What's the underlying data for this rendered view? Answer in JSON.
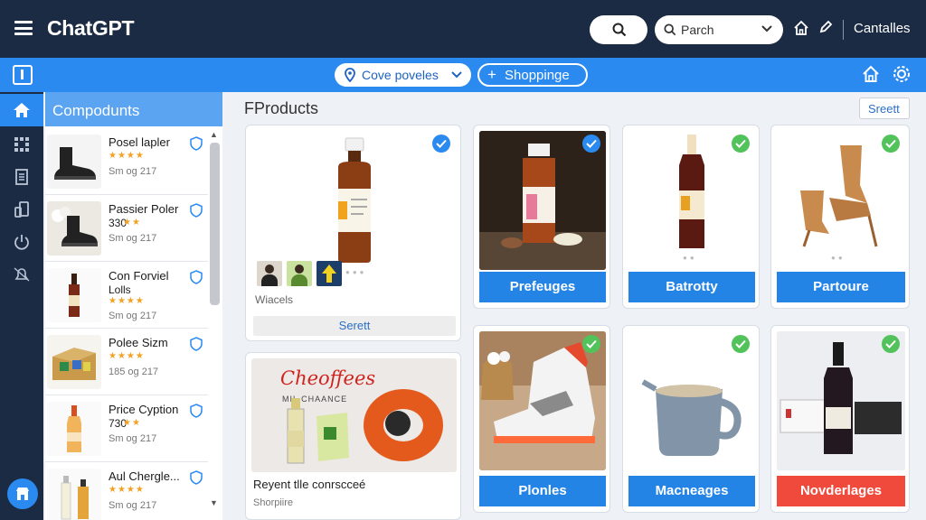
{
  "header": {
    "title": "ChatGPT",
    "search_placeholder": "Parch",
    "right_label": "Cantalles"
  },
  "toolbar": {
    "select_value": "Cove poveles",
    "shop_label": "Shoppinge"
  },
  "sidebar": {
    "title": "Compodunts",
    "items": [
      {
        "name": "Posel lapler",
        "stars": "★★★★",
        "meta": "Sm og 217",
        "sub": ""
      },
      {
        "name": "Passier Poler",
        "sub": "330",
        "stars": "★★",
        "meta": "Sm og 217"
      },
      {
        "name": "Con Forviel",
        "sub": "Lolls",
        "stars": "★★★★",
        "meta": "Sm og 217"
      },
      {
        "name": "Polee Sizm",
        "stars": "★★★★",
        "meta": "185 og 217",
        "sub": ""
      },
      {
        "name": "Price Cyption",
        "sub": "730",
        "stars": "★★",
        "meta": "Sm og 217"
      },
      {
        "name": "Aul Chergle...",
        "stars": "★★★★",
        "meta": "Sm og 217",
        "sub": ""
      }
    ]
  },
  "main": {
    "title": "FProducts",
    "top_button": "Sreett",
    "featured": {
      "caption": "Wiacels",
      "button": "Serett"
    },
    "promo": {
      "heading": "Cheoffees",
      "subheading": "MIL CHAANCE",
      "caption": "Reyent tlle conrscceé",
      "meta": "Shorpiire"
    },
    "products": [
      {
        "label": "Prefeuges",
        "color": "#2384e6"
      },
      {
        "label": "Batrotty",
        "color": "#2384e6"
      },
      {
        "label": "Partoure",
        "color": "#2384e6"
      },
      {
        "label": "Plonles",
        "color": "#2384e6"
      },
      {
        "label": "Macneages",
        "color": "#2384e6"
      },
      {
        "label": "Novderlages",
        "color": "#ef4a3c"
      }
    ]
  }
}
